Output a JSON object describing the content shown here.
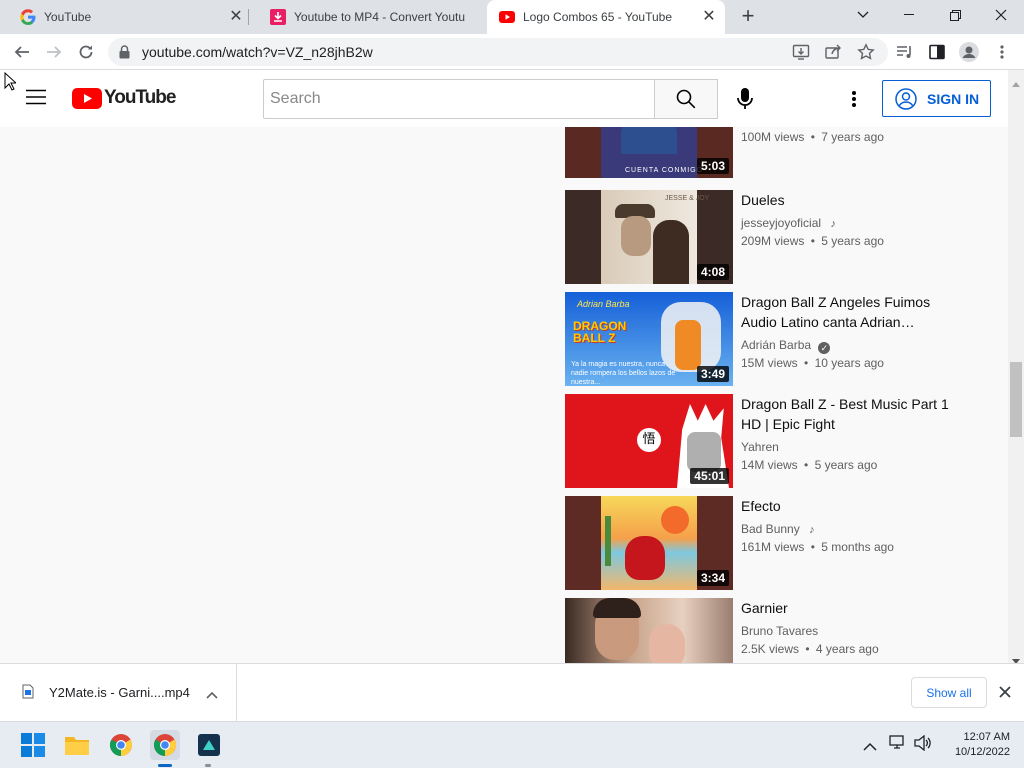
{
  "browser": {
    "tabs": [
      {
        "title": "YouTube",
        "active": false
      },
      {
        "title": "Youtube to MP4 - Convert Youtu",
        "active": false
      },
      {
        "title": "Logo Combos 65 - YouTube",
        "active": true
      }
    ],
    "new_tab": "+",
    "url": "youtube.com/watch?v=VZ_n28jhB2w"
  },
  "youtube": {
    "logo_text": "YouTube",
    "search_placeholder": "Search",
    "sign_in_label": "SIGN IN"
  },
  "videos": [
    {
      "title": "",
      "channel": "",
      "views": "100M views",
      "age": "7 years ago",
      "duration": "5:03",
      "music": false,
      "verified": false
    },
    {
      "title": "Dueles",
      "channel": "jesseyjoyoficial",
      "views": "209M views",
      "age": "5 years ago",
      "duration": "4:08",
      "music": true,
      "verified": false
    },
    {
      "title": "Dragon Ball Z Angeles Fuimos Audio Latino canta Adrian…",
      "channel": "Adrián Barba",
      "views": "15M views",
      "age": "10 years ago",
      "duration": "3:49",
      "music": false,
      "verified": true
    },
    {
      "title": "Dragon Ball Z - Best Music Part 1 HD | Epic Fight",
      "channel": "Yahren",
      "views": "14M views",
      "age": "5 years ago",
      "duration": "45:01",
      "music": false,
      "verified": false
    },
    {
      "title": "Efecto",
      "channel": "Bad Bunny",
      "views": "161M views",
      "age": "5 months ago",
      "duration": "3:34",
      "music": true,
      "verified": false
    },
    {
      "title": "Garnier",
      "channel": "Bruno Tavares",
      "views": "2.5K views",
      "age": "4 years ago",
      "duration": "",
      "music": false,
      "verified": false
    }
  ],
  "thumb_text": {
    "v0_caption": "CUENTA CONMIGO",
    "v1_caption": "JESSE & JOY",
    "v2_brand": "Adrian Barba",
    "v2_logo": "DRAGON BALL Z",
    "v2_subtitle": "Ya la magia es nuestra, nunca nadie rompera los bellos lazos de nuestra...",
    "v3_emblem": "悟"
  },
  "separator": "•",
  "downloads": {
    "filename": "Y2Mate.is - Garni....mp4",
    "show_all": "Show all"
  },
  "taskbar": {
    "time": "12:07 AM",
    "date": "10/12/2022"
  },
  "colors": {
    "youtube_red": "#ff0000",
    "link_blue": "#065fd4",
    "chrome_tabbar": "#dee1e6"
  }
}
